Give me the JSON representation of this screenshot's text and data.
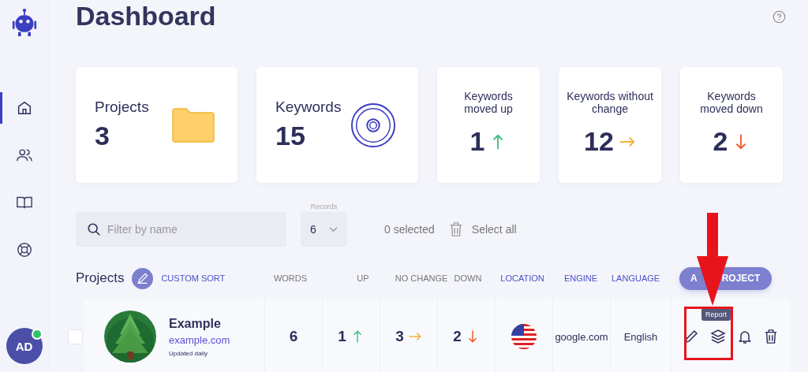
{
  "sidebar": {
    "items": [
      {
        "selected": true
      },
      {
        "selected": false
      },
      {
        "selected": false
      },
      {
        "selected": false
      }
    ],
    "avatar": {
      "initials": "AD",
      "online": true
    }
  },
  "title": "Dashboard",
  "stats": [
    {
      "kind": "folder",
      "label": "Projects",
      "value": "3"
    },
    {
      "kind": "target",
      "label": "Keywords",
      "value": "15"
    },
    {
      "kind": "up",
      "label": "Keywords moved up",
      "value": "1"
    },
    {
      "kind": "flat",
      "label": "Keywords without change",
      "value": "12"
    },
    {
      "kind": "down",
      "label": "Keywords moved down",
      "value": "2"
    }
  ],
  "filter": {
    "placeholder": "Filter by name",
    "records_label": "Records",
    "records_value": "6",
    "selected_count": "0 selected",
    "select_all": "Select all"
  },
  "table": {
    "title": "Projects",
    "custom_sort": "CUSTOM SORT",
    "columns": [
      {
        "label": "WORDS",
        "sortable": false
      },
      {
        "label": "UP",
        "sortable": false
      },
      {
        "label": "NO CHANGE",
        "sortable": false
      },
      {
        "label": "DOWN",
        "sortable": false
      },
      {
        "label": "LOCATION",
        "sortable": true
      },
      {
        "label": "ENGINE",
        "sortable": true
      },
      {
        "label": "LANGUAGE",
        "sortable": true
      }
    ],
    "add_button_visible_parts": [
      "A",
      "ROJECT"
    ],
    "rows": [
      {
        "checked": false,
        "name": "Example",
        "url": "example.com",
        "note": "Updated daily",
        "words": "6",
        "up": "1",
        "no_change": "3",
        "down": "2",
        "engine": "google.com",
        "language": "English",
        "tooltip": "Report"
      }
    ]
  }
}
